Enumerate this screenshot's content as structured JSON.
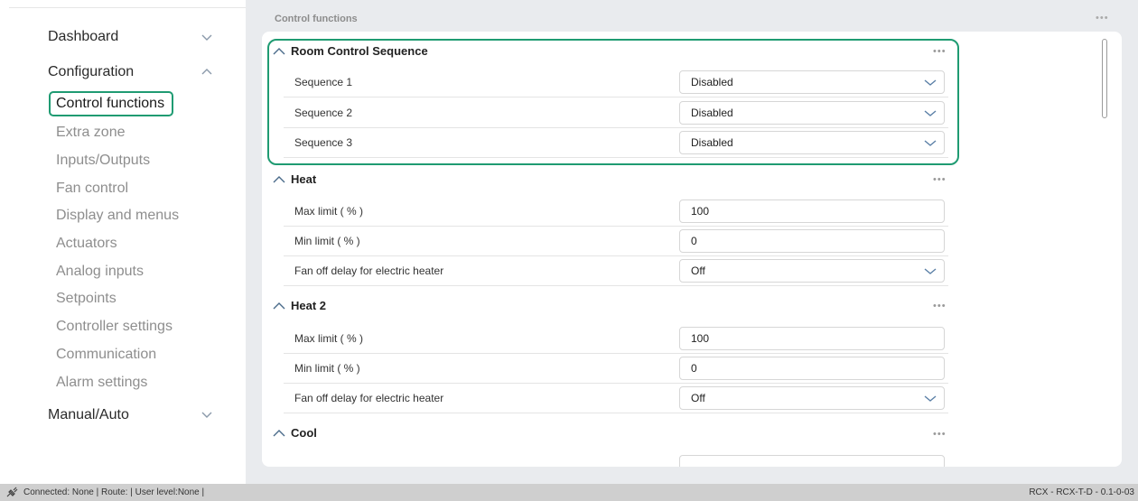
{
  "sidebar": {
    "dashboard": "Dashboard",
    "configuration": "Configuration",
    "active": "Control functions",
    "subitems": [
      "Extra zone",
      "Inputs/Outputs",
      "Fan control",
      "Display and menus",
      "Actuators",
      "Analog inputs",
      "Setpoints",
      "Controller settings",
      "Communication",
      "Alarm settings"
    ],
    "manual": "Manual/Auto"
  },
  "main": {
    "title": "Control functions",
    "menu_dots": "•••",
    "sections": [
      {
        "title": "Room Control Sequence",
        "rows": [
          {
            "label": "Sequence 1",
            "value": "Disabled",
            "kind": "dropdown"
          },
          {
            "label": "Sequence 2",
            "value": "Disabled",
            "kind": "dropdown"
          },
          {
            "label": "Sequence 3",
            "value": "Disabled",
            "kind": "dropdown"
          }
        ]
      },
      {
        "title": "Heat",
        "rows": [
          {
            "label": "Max limit ( % )",
            "value": "100",
            "kind": "input"
          },
          {
            "label": "Min limit ( % )",
            "value": "0",
            "kind": "input"
          },
          {
            "label": "Fan off delay for electric heater",
            "value": "Off",
            "kind": "dropdown"
          }
        ]
      },
      {
        "title": "Heat 2",
        "rows": [
          {
            "label": "Max limit ( % )",
            "value": "100",
            "kind": "input"
          },
          {
            "label": "Min limit ( % )",
            "value": "0",
            "kind": "input"
          },
          {
            "label": "Fan off delay for electric heater",
            "value": "Off",
            "kind": "dropdown"
          }
        ]
      },
      {
        "title": "Cool",
        "rows": []
      }
    ]
  },
  "statusbar": {
    "status": "Connected: None | Route: | User level:None |",
    "version": "RCX - RCX-T-D - 0.1-0-03"
  },
  "colors": {
    "accent": "#1f9b72",
    "background": "#e9ebee",
    "statusbar": "#cfcfcf"
  },
  "icons": {
    "expand": "chevron-down-icon",
    "collapse": "chevron-up-icon",
    "dropdown": "chevron-down-icon",
    "connection": "plug-icon"
  }
}
